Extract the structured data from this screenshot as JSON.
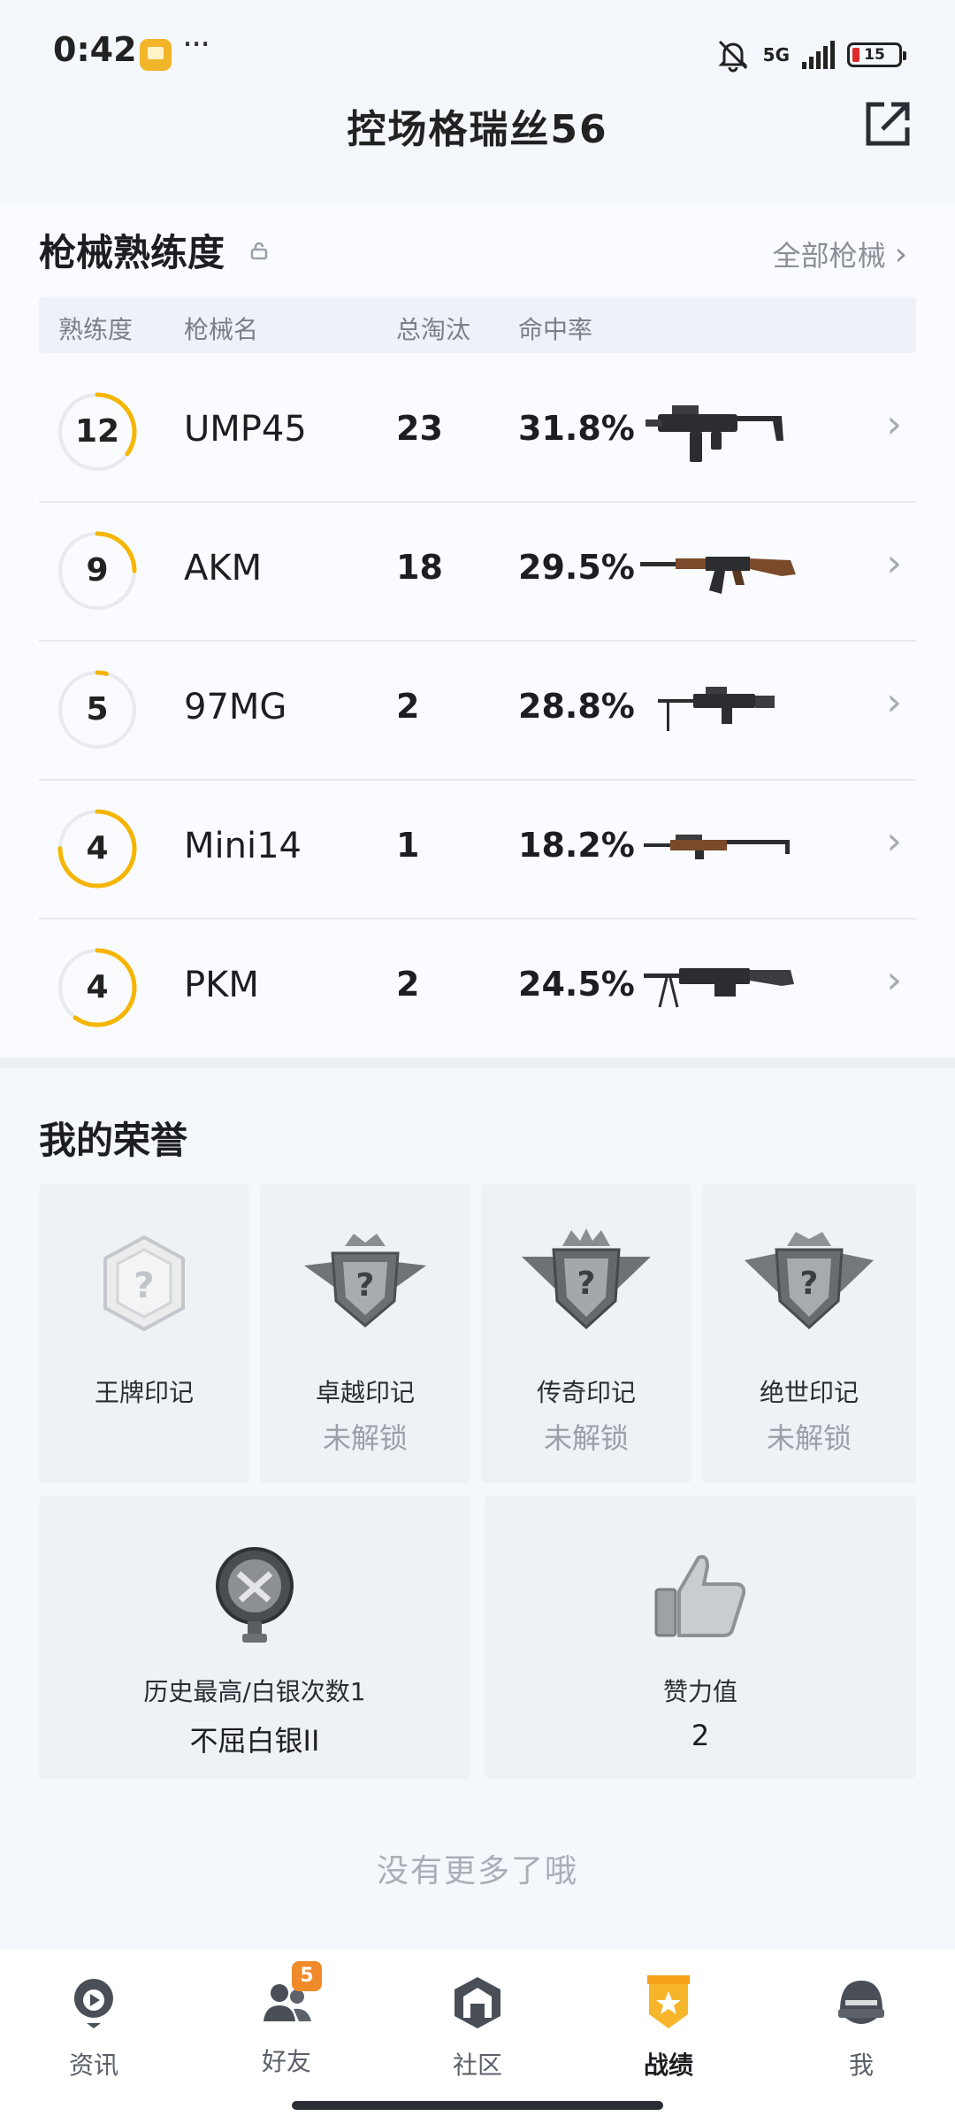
{
  "status_bar": {
    "time": "0:42",
    "dots": "···",
    "network": "5G",
    "battery": "15"
  },
  "header": {
    "title": "控场格瑞丝56"
  },
  "mastery": {
    "title": "枪械熟练度",
    "all_link": "全部枪械",
    "columns": [
      "熟练度",
      "枪械名",
      "总淘汰",
      "命中率"
    ],
    "rows": [
      {
        "level": "12",
        "name": "UMP45",
        "kills": "23",
        "rate": "31.8%",
        "progress": 0.35
      },
      {
        "level": "9",
        "name": "AKM",
        "kills": "18",
        "rate": "29.5%",
        "progress": 0.25
      },
      {
        "level": "5",
        "name": "97MG",
        "kills": "2",
        "rate": "28.8%",
        "progress": 0.04
      },
      {
        "level": "4",
        "name": "Mini14",
        "kills": "1",
        "rate": "18.2%",
        "progress": 0.75
      },
      {
        "level": "4",
        "name": "PKM",
        "kills": "2",
        "rate": "24.5%",
        "progress": 0.6
      }
    ],
    "ring_color": "#f5b500"
  },
  "honors": {
    "title": "我的荣誉",
    "marks": [
      {
        "label": "王牌印记",
        "status": ""
      },
      {
        "label": "卓越印记",
        "status": "未解锁"
      },
      {
        "label": "传奇印记",
        "status": "未解锁"
      },
      {
        "label": "绝世印记",
        "status": "未解锁"
      }
    ],
    "rank": {
      "label": "历史最高/白银次数1",
      "value": "不屈白银II"
    },
    "likes": {
      "label": "赞力值",
      "value": "2"
    }
  },
  "footer_text": "没有更多了哦",
  "nav": {
    "items": [
      {
        "label": "资讯",
        "icon": "news-icon"
      },
      {
        "label": "好友",
        "icon": "friends-icon",
        "badge": "5"
      },
      {
        "label": "社区",
        "icon": "community-icon"
      },
      {
        "label": "战绩",
        "icon": "record-icon"
      },
      {
        "label": "我",
        "icon": "profile-icon"
      }
    ],
    "active": "战绩"
  }
}
